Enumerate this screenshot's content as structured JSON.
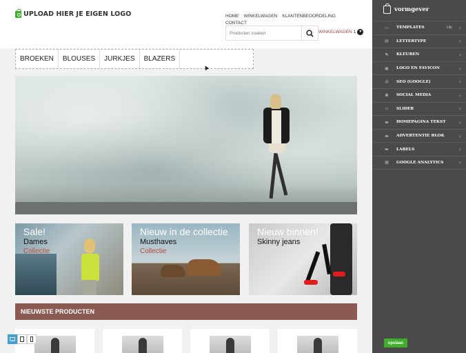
{
  "site": {
    "logo_text": "UPLOAD HIER JE EIGEN LOGO",
    "top_nav": [
      "HOME",
      "WINKELWAGEN",
      "KLANTENBEOORDELING",
      "CONTACT"
    ],
    "search_placeholder": "Producten zoeken",
    "cart_label": "WINKELWAGEN",
    "cart_count": "1",
    "categories": [
      "BROEKEN",
      "BLOUSES",
      "JURKJES",
      "BLAZERS"
    ],
    "promos": [
      {
        "title": "Sale!",
        "sub": "Dames",
        "accent": "Collectie"
      },
      {
        "title": "Nieuw in de collectie",
        "sub": "Musthaves",
        "accent": "Collectie"
      },
      {
        "title": "Nieuw binnen!",
        "sub": "Skinny jeans",
        "accent": ""
      }
    ],
    "newest_title": "NIEUWSTE PRODUCTEN"
  },
  "sidebar": {
    "brand": "vormgever",
    "items": [
      {
        "label": "TEMPLATES",
        "extra": "Lily",
        "icon": "template-icon"
      },
      {
        "label": "LETTERTYPE",
        "extra": "",
        "icon": "font-icon"
      },
      {
        "label": "KLEUREN",
        "extra": "",
        "icon": "color-icon"
      },
      {
        "label": "LOGO EN FAVICON",
        "extra": "",
        "icon": "logo-icon"
      },
      {
        "label": "SEO (GOOGLE)",
        "extra": "",
        "icon": "globe-icon"
      },
      {
        "label": "SOCIAL MEDIA",
        "extra": "",
        "icon": "social-icon"
      },
      {
        "label": "SLIDER",
        "extra": "",
        "icon": "slider-icon"
      },
      {
        "label": "HOMEPAGINA TEKST",
        "extra": "",
        "icon": "text-icon"
      },
      {
        "label": "ADVERTENTIE BLOK",
        "extra": "",
        "icon": "ad-icon"
      },
      {
        "label": "LABELS",
        "extra": "",
        "icon": "label-icon"
      },
      {
        "label": "GOOGLE ANALYTICS",
        "extra": "",
        "icon": "analytics-icon"
      }
    ],
    "save_label": "opslaan"
  },
  "colors": {
    "accent_green": "#3fae2a",
    "newest_bar": "#8b5a52",
    "sidebar_bg": "#4a4a4a",
    "promo_accent": "#c0463c"
  }
}
